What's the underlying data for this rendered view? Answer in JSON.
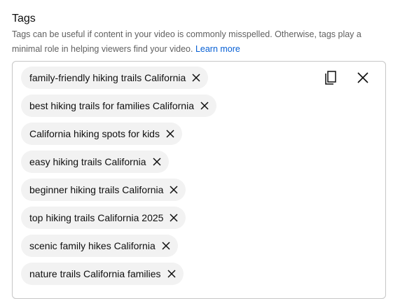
{
  "tags_section": {
    "title": "Tags",
    "description": "Tags can be useful if content in your video is commonly misspelled. Otherwise, tags play a minimal role in helping viewers find your video.",
    "learn_more": "Learn more"
  },
  "tags": [
    "family-friendly hiking trails California",
    "best hiking trails for families California",
    "California hiking spots for kids",
    "easy hiking trails California",
    "beginner hiking trails California",
    "top hiking trails California 2025",
    "scenic family hikes California",
    "nature trails California families"
  ],
  "toolbar": {
    "copy_icon": "copy-icon",
    "clear_icon": "close-icon"
  },
  "colors": {
    "chip_bg": "#f2f2f2",
    "link": "#065fd4",
    "secondary_text": "#606060",
    "border": "#c6c6c6"
  }
}
